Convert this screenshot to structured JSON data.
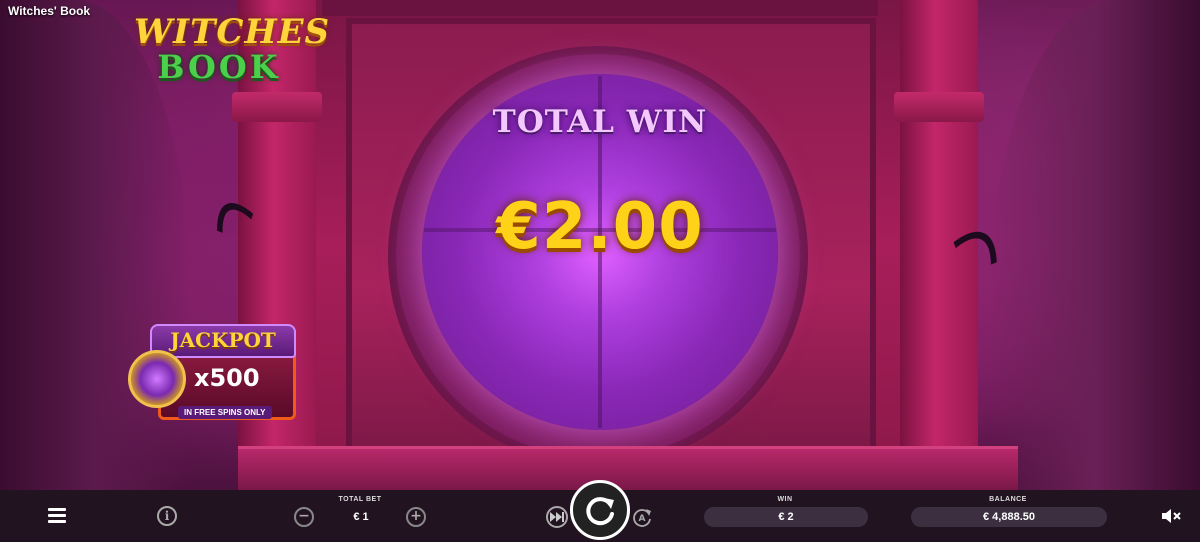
{
  "window": {
    "title": "Witches' Book"
  },
  "logo": {
    "line1": "WITCHES",
    "line2": "BOOK"
  },
  "win_display": {
    "title": "TOTAL WIN",
    "amount": "€2.00"
  },
  "jackpot": {
    "title": "JACKPOT",
    "multiplier": "x500",
    "note": "IN FREE SPINS ONLY"
  },
  "bottom_bar": {
    "total_bet_label": "TOTAL BET",
    "total_bet_value": "€ 1",
    "minus_label": "−",
    "plus_label": "+",
    "info_label": "i",
    "win_label": "WIN",
    "win_value": "€ 2",
    "balance_label": "BALANCE",
    "balance_value": "€ 4,888.50"
  },
  "icons": {
    "menu": "hamburger-menu-icon",
    "info": "info-icon",
    "spin": "spin-icon",
    "turbo": "fast-forward-icon",
    "auto": "autoplay-icon",
    "sound": "speaker-muted-icon"
  },
  "colors": {
    "gold": "#ffd21a",
    "win_title": "#f4c8ff",
    "bar_bg": "#1e141e",
    "field_bg": "#3c3040"
  }
}
